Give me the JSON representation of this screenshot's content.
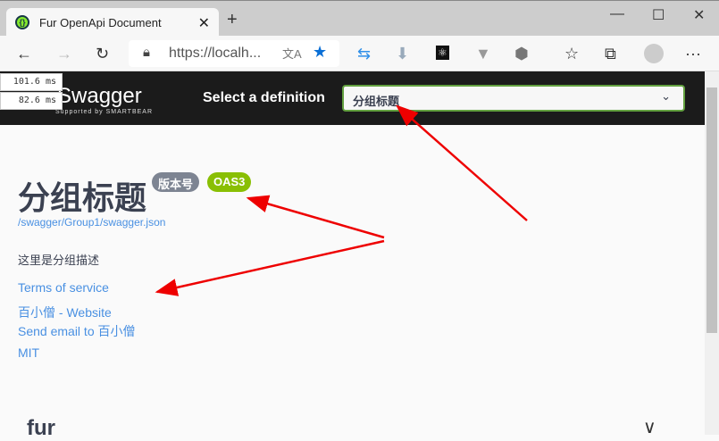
{
  "browser": {
    "tab_title": "Fur OpenApi Document",
    "url": "https://localh..."
  },
  "timing": [
    "101.6 ms",
    "82.6 ms"
  ],
  "header": {
    "logo": "Swagger",
    "logo_sub": "Supported by SMARTBEAR",
    "select_label": "Select a definition",
    "selected": "分组标题"
  },
  "info": {
    "title": "分组标题",
    "version": "版本号",
    "oas": "OAS3",
    "spec_url": "/swagger/Group1/swagger.json",
    "description": "这里是分组描述",
    "terms": "Terms of service",
    "website": "百小僧 - Website",
    "email": "Send email to 百小僧",
    "license": "MIT"
  },
  "section": {
    "name": "fur"
  },
  "colors": {
    "accent": "#62a03f",
    "oas": "#89bf04",
    "version": "#7d8492",
    "link": "#4990e2"
  }
}
